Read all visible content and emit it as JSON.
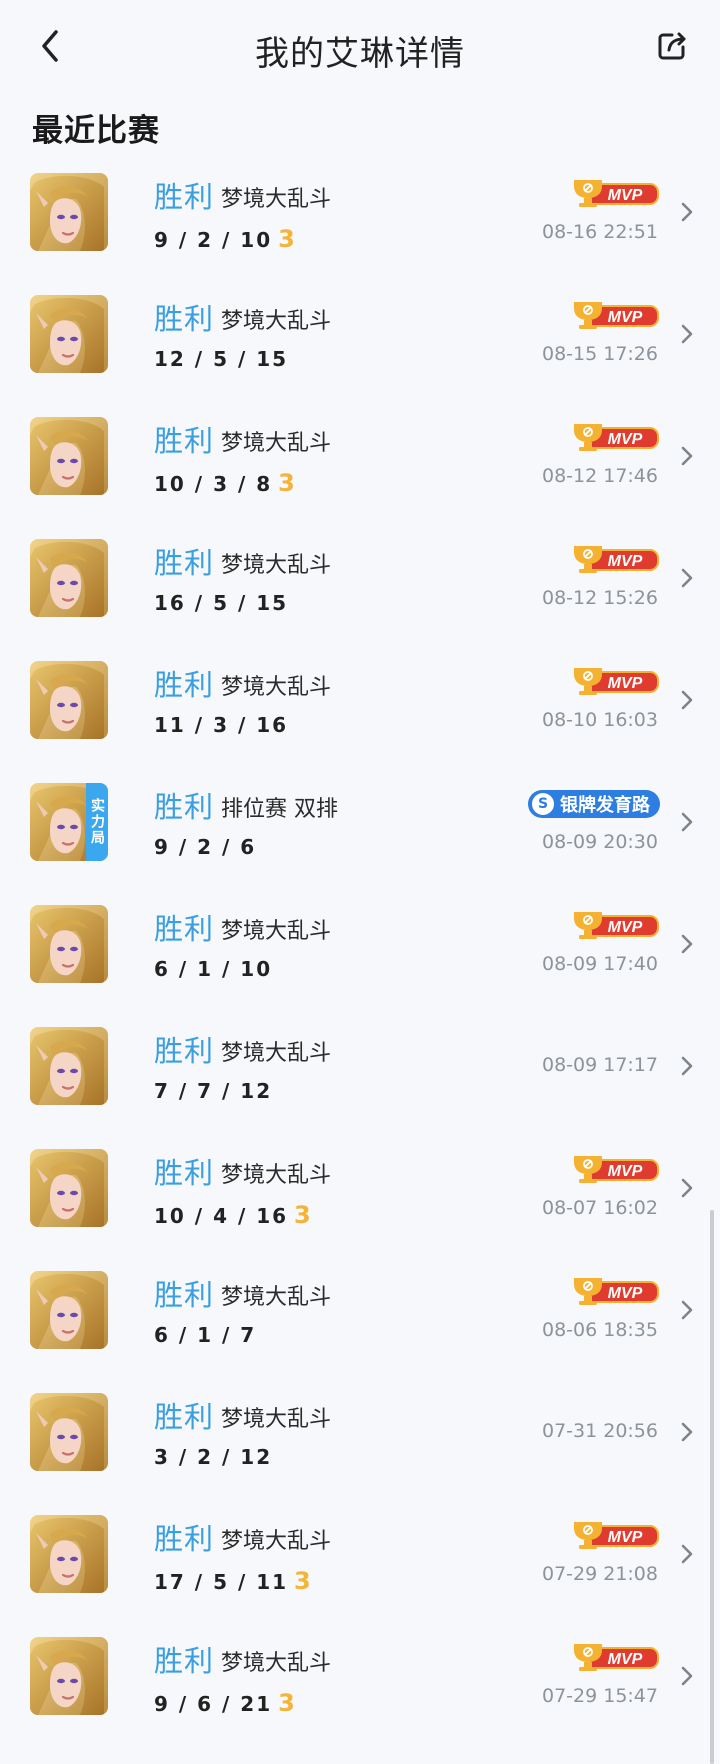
{
  "header": {
    "title": "我的艾琳详情"
  },
  "section": {
    "title": "最近比赛"
  },
  "matches": [
    {
      "result": "胜利",
      "mode": "梦境大乱斗",
      "kda": "9 / 2 / 10",
      "triple": "3",
      "badge": "MVP",
      "time": "08-16 22:51"
    },
    {
      "result": "胜利",
      "mode": "梦境大乱斗",
      "kda": "12 / 5 / 15",
      "triple": "",
      "badge": "MVP",
      "time": "08-15 17:26"
    },
    {
      "result": "胜利",
      "mode": "梦境大乱斗",
      "kda": "10 / 3 / 8",
      "triple": "3",
      "badge": "MVP",
      "time": "08-12 17:46"
    },
    {
      "result": "胜利",
      "mode": "梦境大乱斗",
      "kda": "16 / 5 / 15",
      "triple": "",
      "badge": "MVP",
      "time": "08-12 15:26"
    },
    {
      "result": "胜利",
      "mode": "梦境大乱斗",
      "kda": "11 / 3 / 16",
      "triple": "",
      "badge": "MVP",
      "time": "08-10 16:03"
    },
    {
      "result": "胜利",
      "mode": "排位赛 双排",
      "kda": "9 / 2 / 6",
      "triple": "",
      "badge": "银牌发育路",
      "time": "08-09 20:30",
      "tag": "实力局"
    },
    {
      "result": "胜利",
      "mode": "梦境大乱斗",
      "kda": "6 / 1 / 10",
      "triple": "",
      "badge": "MVP",
      "time": "08-09 17:40"
    },
    {
      "result": "胜利",
      "mode": "梦境大乱斗",
      "kda": "7 / 7 / 12",
      "triple": "",
      "badge": "",
      "time": "08-09 17:17"
    },
    {
      "result": "胜利",
      "mode": "梦境大乱斗",
      "kda": "10 / 4 / 16",
      "triple": "3",
      "badge": "MVP",
      "time": "08-07 16:02"
    },
    {
      "result": "胜利",
      "mode": "梦境大乱斗",
      "kda": "6 / 1 / 7",
      "triple": "",
      "badge": "MVP",
      "time": "08-06 18:35"
    },
    {
      "result": "胜利",
      "mode": "梦境大乱斗",
      "kda": "3 / 2 / 12",
      "triple": "",
      "badge": "",
      "time": "07-31 20:56"
    },
    {
      "result": "胜利",
      "mode": "梦境大乱斗",
      "kda": "17 / 5 / 11",
      "triple": "3",
      "badge": "MVP",
      "time": "07-29 21:08"
    },
    {
      "result": "胜利",
      "mode": "梦境大乱斗",
      "kda": "9 / 6 / 21",
      "triple": "3",
      "badge": "MVP",
      "time": "07-29 15:47"
    }
  ],
  "icons": {
    "back": "chevron-left-icon",
    "share": "share-icon",
    "row_chevron": "chevron-right-icon",
    "mvp": "trophy-icon",
    "silver": "silver-medal-icon"
  },
  "colors": {
    "result": "#3a9ee0",
    "mvp_red": "#e03b2f",
    "trophy_gold": "#f3b231",
    "triple": "#f2b43a",
    "silver_badge": "#2d7ee0",
    "power_tag": "#3aa7ef"
  }
}
